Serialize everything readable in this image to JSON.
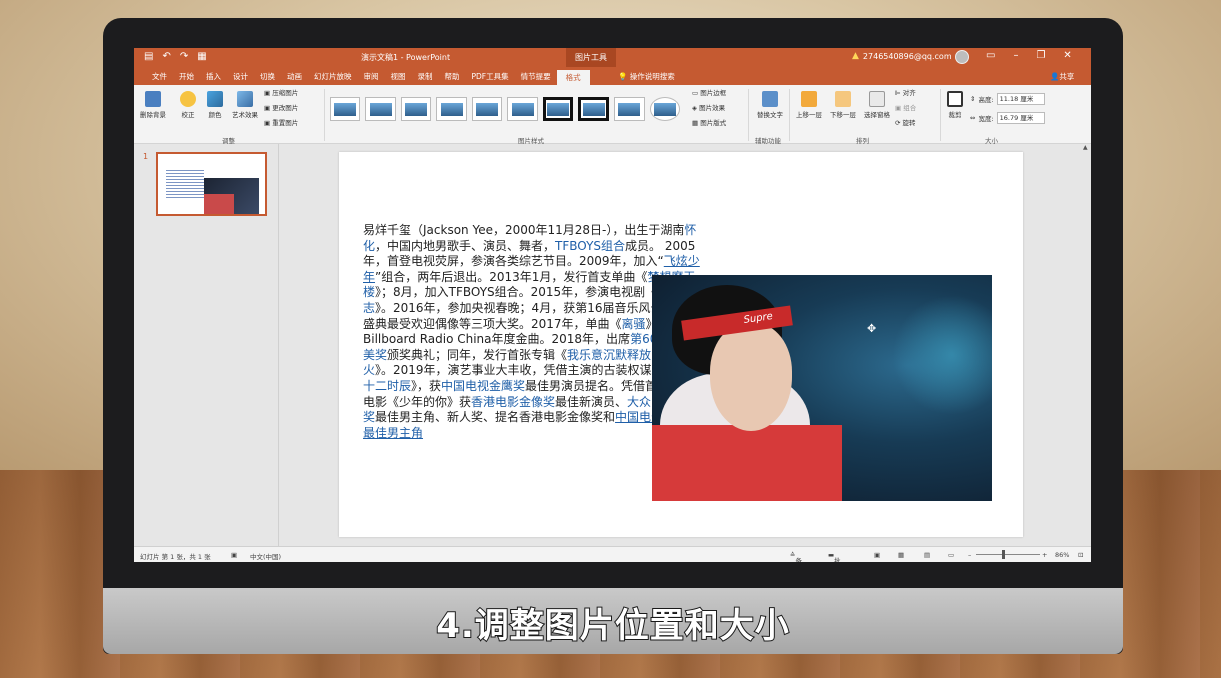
{
  "caption": "4.调整图片位置和大小",
  "titlebar": {
    "quick_access": [
      "▤",
      "↶",
      "↷",
      "▦"
    ],
    "doc_title": "演示文稿1 - PowerPoint",
    "context_tab": "图片工具",
    "user_email": "2746540896@qq.com",
    "window_buttons": [
      "▭",
      "–",
      "❐",
      "✕"
    ]
  },
  "tabs": [
    "文件",
    "开始",
    "插入",
    "设计",
    "切换",
    "动画",
    "幻灯片放映",
    "审阅",
    "视图",
    "录制",
    "帮助",
    "PDF工具集",
    "情节提要",
    "格式"
  ],
  "active_tab": "格式",
  "tell_me": "操作说明搜索",
  "share": "共享",
  "ribbon": {
    "adjust": {
      "remove_bg": "删除背景",
      "corrections": "校正",
      "color": "颜色",
      "artistic": "艺术效果",
      "compress": "压缩图片",
      "change": "更改图片",
      "reset": "重置图片",
      "label": "调整"
    },
    "styles": {
      "border": "图片边框",
      "effects": "图片效果",
      "layout": "图片版式",
      "label": "图片样式"
    },
    "accessibility": {
      "alt_text": "替换文字",
      "label": "辅助功能"
    },
    "arrange": {
      "bring_forward": "上移一层",
      "send_backward": "下移一层",
      "selection_pane": "选择窗格",
      "align": "对齐",
      "group": "组合",
      "rotate": "旋转",
      "label": "排列"
    },
    "size": {
      "crop": "裁剪",
      "height_label": "高度:",
      "height_value": "11.18 厘米",
      "width_label": "宽度:",
      "width_value": "16.79 厘米",
      "label": "大小"
    }
  },
  "slide_pane": {
    "slide_number": "1"
  },
  "slide": {
    "image_band_text": "Supre",
    "paragraph": [
      {
        "t": "易烊千玺（Jackson Yee，2000年11月28日-），出生于湖南"
      },
      {
        "t": "怀化",
        "c": "lk"
      },
      {
        "t": "，中国内地男歌手、演员、舞者，"
      },
      {
        "t": "TFBOYS组合",
        "c": "lk"
      },
      {
        "t": "成员。 2005年，首登电视荧屏，参演各类综艺节目。2009年，加入“"
      },
      {
        "t": "飞炫少年",
        "c": "lku"
      },
      {
        "t": "”组合，两年后退出。2013年1月，发行首支单曲《"
      },
      {
        "t": "梦想摩天楼",
        "c": "lk"
      },
      {
        "t": "》；8月，加入TFBOYS组合。2015年，参演电视剧《"
      },
      {
        "t": "青云志",
        "c": "lk"
      },
      {
        "t": "》。2016年，参加央视春晚；4月，获第16届音乐风云榜年度盛典最受欢迎偶像等三项大奖。2017年，单曲《"
      },
      {
        "t": "离骚",
        "c": "lk"
      },
      {
        "t": "》获得Billboard Radio China年度金曲。2018年，出席"
      },
      {
        "t": "第60届格莱美奖",
        "c": "lk"
      },
      {
        "t": "颁奖典礼；同年，发行首张专辑《"
      },
      {
        "t": "我乐意沉默释放内心焰火",
        "c": "lk"
      },
      {
        "t": "》。2019年，演艺事业大丰收，凭借主演的古装权谋剧《"
      },
      {
        "t": "长安十二时辰",
        "c": "lk"
      },
      {
        "t": "》，获"
      },
      {
        "t": "中国电视金鹰奖",
        "c": "lk"
      },
      {
        "t": "最佳男演员提名。凭借首部主演电影《少年的你》获"
      },
      {
        "t": "香港电影金像奖",
        "c": "lk"
      },
      {
        "t": "最佳新演员、"
      },
      {
        "t": "大众电影百花奖",
        "c": "lk"
      },
      {
        "t": "最佳男主角、新人奖、提名香港电影金像奖和"
      },
      {
        "t": "中国电影金鸡奖最佳男主角",
        "c": "lku"
      }
    ]
  },
  "status": {
    "slide_info": "幻灯片 第 1 张，共 1 张",
    "language": "中文(中国)",
    "notes": "备注",
    "comments": "批注",
    "zoom": "86%"
  }
}
